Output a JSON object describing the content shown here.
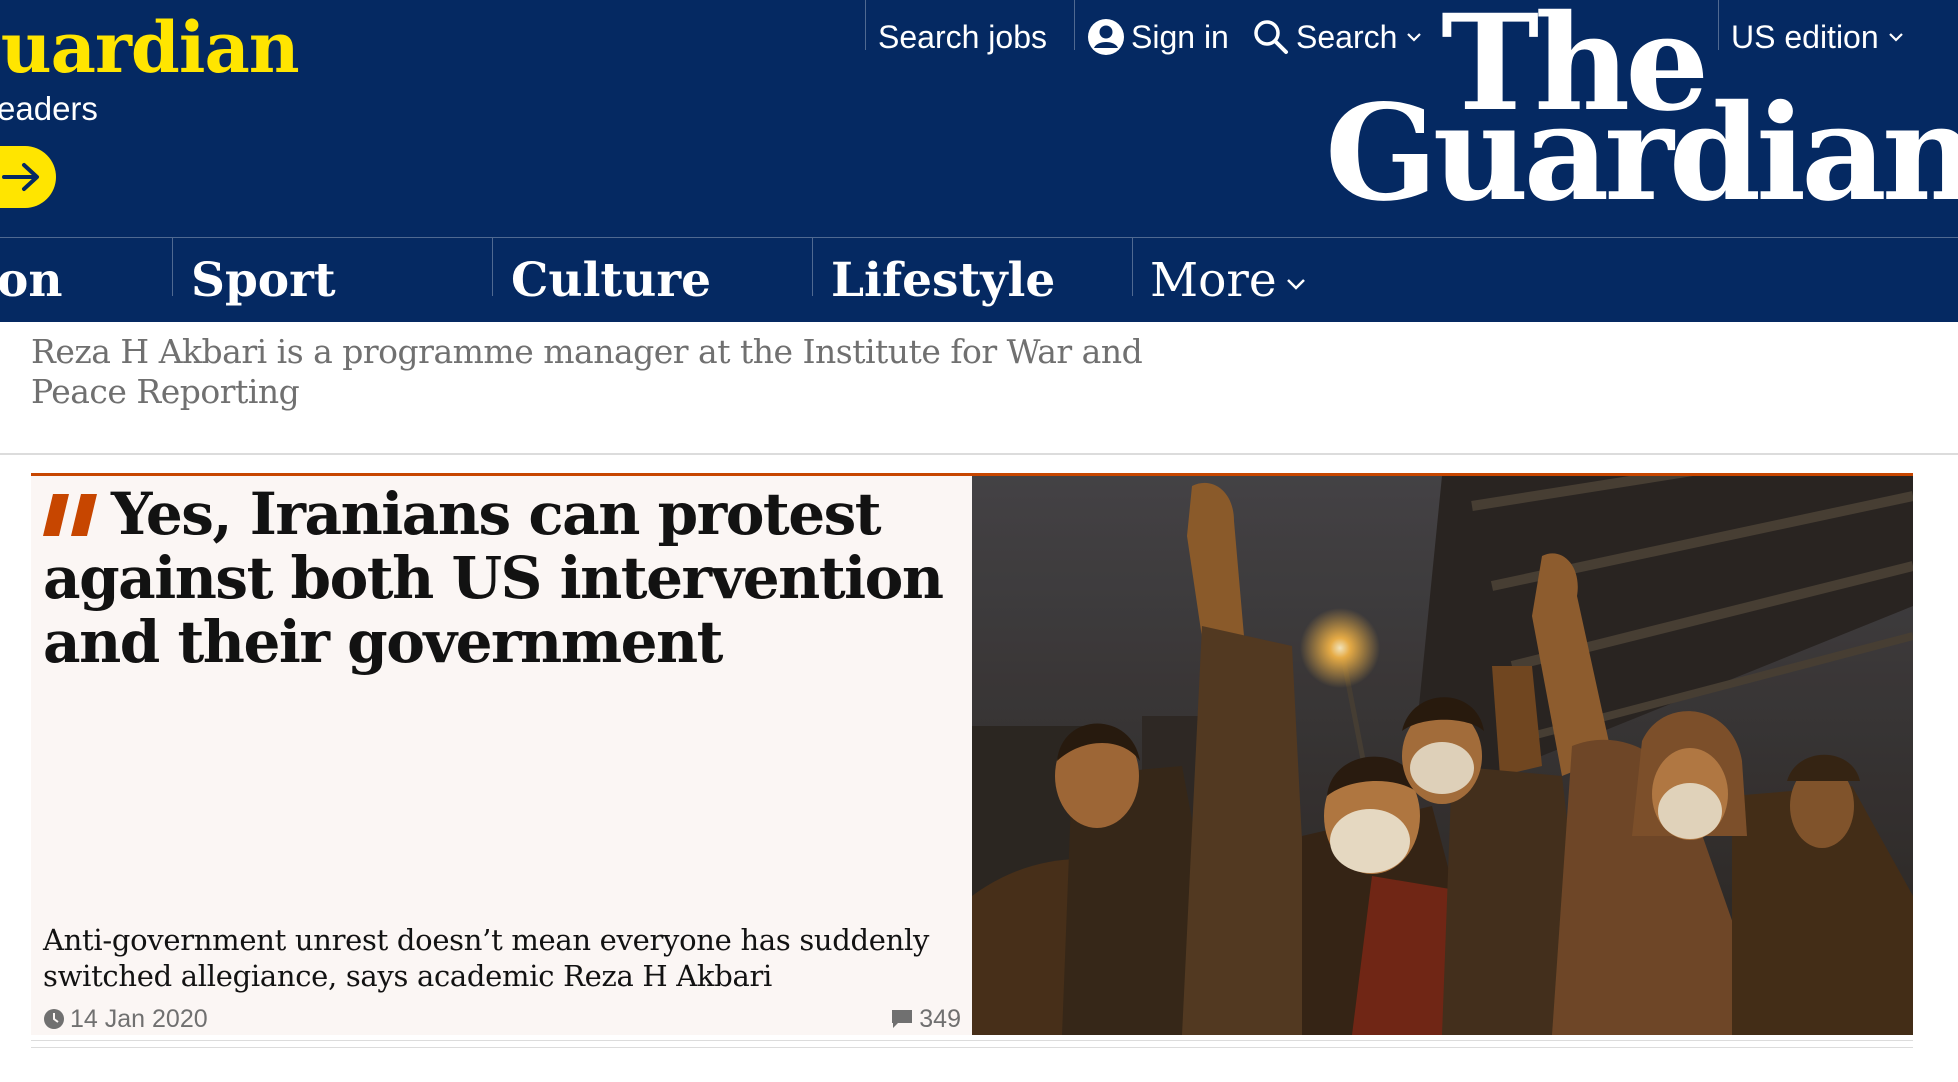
{
  "header": {
    "support_title": "Guardian",
    "support_subtitle": "by readers",
    "search_jobs": "Search jobs",
    "sign_in": "Sign in",
    "search": "Search",
    "edition": "US edition",
    "logo_line1": "The",
    "logo_line2": "Guardian"
  },
  "nav": {
    "items": [
      "on",
      "Sport",
      "Culture",
      "Lifestyle"
    ],
    "more": "More"
  },
  "byline": "Reza H Akbari is a programme manager at the Institute for War and Peace Reporting",
  "article": {
    "headline": "Yes, Iranians can protest against both US intervention and their government",
    "standfirst": "Anti-government unrest doesn’t mean everyone has suddenly switched allegiance, says academic Reza H Akbari",
    "date": "14 Jan 2020",
    "comments": "349"
  },
  "colors": {
    "brand_blue": "#052962",
    "support_yellow": "#ffe500",
    "opinion_orange": "#c74600",
    "card_bg": "#fbf6f4"
  },
  "icons": [
    "arrow-right-icon",
    "user-icon",
    "search-icon",
    "chevron-down-icon",
    "quote-icon",
    "clock-icon",
    "comment-icon"
  ]
}
